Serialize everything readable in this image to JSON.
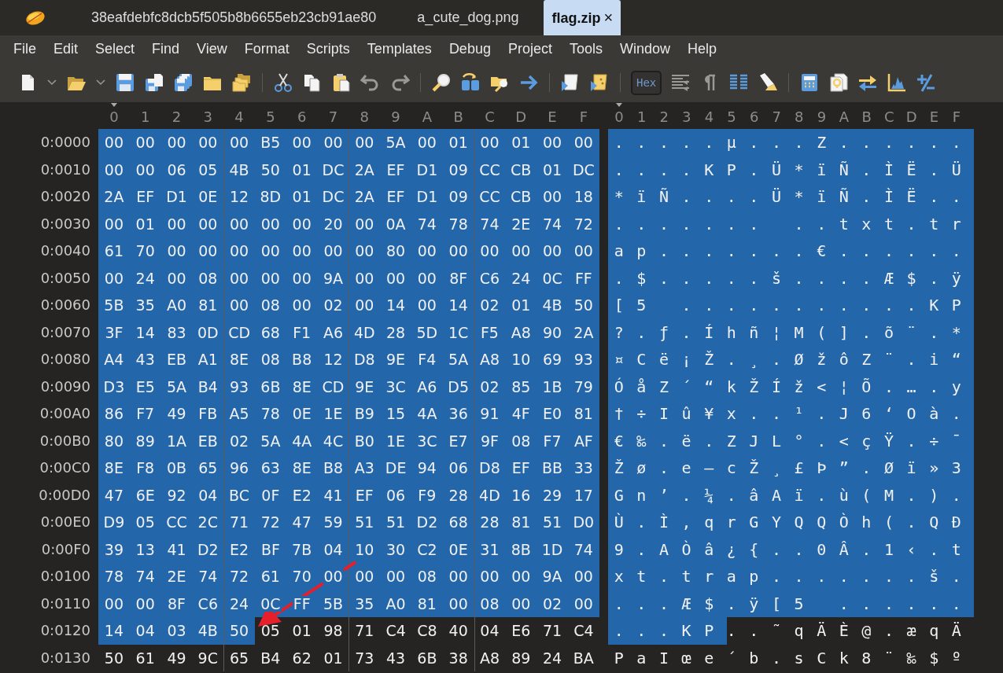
{
  "tabs": [
    {
      "label": "38eafdebfc8dcb5f505b8b6655eb23cb91ae80",
      "selected": false
    },
    {
      "label": "a_cute_dog.png",
      "selected": false
    },
    {
      "label": "flag.zip",
      "selected": true,
      "close": "×"
    }
  ],
  "menu": [
    "File",
    "Edit",
    "Select",
    "Find",
    "View",
    "Format",
    "Scripts",
    "Templates",
    "Debug",
    "Project",
    "Tools",
    "Window",
    "Help"
  ],
  "hex_toggle": {
    "label": "Hex",
    "on": true
  },
  "hex_columns": [
    {
      "label": "0",
      "cursor": true
    },
    {
      "label": "1",
      "cursor": false
    },
    {
      "label": "2",
      "cursor": false
    },
    {
      "label": "3",
      "cursor": false
    },
    {
      "label": "4",
      "cursor": false
    },
    {
      "label": "5",
      "cursor": false
    },
    {
      "label": "6",
      "cursor": false
    },
    {
      "label": "7",
      "cursor": false
    },
    {
      "label": "8",
      "cursor": false
    },
    {
      "label": "9",
      "cursor": false
    },
    {
      "label": "A",
      "cursor": false
    },
    {
      "label": "B",
      "cursor": false
    },
    {
      "label": "C",
      "cursor": false
    },
    {
      "label": "D",
      "cursor": false
    },
    {
      "label": "E",
      "cursor": false
    },
    {
      "label": "F",
      "cursor": false
    }
  ],
  "ascii_columns": [
    {
      "label": "0",
      "cursor": true
    },
    {
      "label": "1",
      "cursor": false
    },
    {
      "label": "2",
      "cursor": false
    },
    {
      "label": "3",
      "cursor": false
    },
    {
      "label": "4",
      "cursor": false
    },
    {
      "label": "5",
      "cursor": false
    },
    {
      "label": "6",
      "cursor": false
    },
    {
      "label": "7",
      "cursor": false
    },
    {
      "label": "8",
      "cursor": false
    },
    {
      "label": "9",
      "cursor": false
    },
    {
      "label": "A",
      "cursor": false
    },
    {
      "label": "B",
      "cursor": false
    },
    {
      "label": "C",
      "cursor": false
    },
    {
      "label": "D",
      "cursor": false
    },
    {
      "label": "E",
      "cursor": false
    },
    {
      "label": "F",
      "cursor": false
    }
  ],
  "rows": [
    {
      "offset": "0:0000",
      "hex_selected": [
        "00",
        "00",
        "00",
        "00",
        "00",
        "B5",
        "00",
        "00",
        "00",
        "5A",
        "00",
        "01",
        "00",
        "01",
        "00",
        "00"
      ],
      "ascii_selected": ".....µ...Z......"
    },
    {
      "offset": "0:0010",
      "hex_selected": [
        "00",
        "00",
        "06",
        "05",
        "4B",
        "50",
        "01",
        "DC",
        "2A",
        "EF",
        "D1",
        "09",
        "CC",
        "CB",
        "01",
        "DC"
      ],
      "ascii_selected": "....KP.Ü*ïÑ.ÌË.Ü"
    },
    {
      "offset": "0:0020",
      "hex_selected": [
        "2A",
        "EF",
        "D1",
        "0E",
        "12",
        "8D",
        "01",
        "DC",
        "2A",
        "EF",
        "D1",
        "09",
        "CC",
        "CB",
        "00",
        "18"
      ],
      "ascii_selected": "*ïÑ....Ü*ïÑ.ÌË.."
    },
    {
      "offset": "0:0030",
      "hex_selected": [
        "00",
        "01",
        "00",
        "00",
        "00",
        "00",
        "00",
        "20",
        "00",
        "0A",
        "74",
        "78",
        "74",
        "2E",
        "74",
        "72"
      ],
      "ascii_selected": "....... ..txt.tr"
    },
    {
      "offset": "0:0040",
      "hex_selected": [
        "61",
        "70",
        "00",
        "00",
        "00",
        "00",
        "00",
        "00",
        "00",
        "80",
        "00",
        "00",
        "00",
        "00",
        "00",
        "00"
      ],
      "ascii_selected": "ap.......€......"
    },
    {
      "offset": "0:0050",
      "hex_selected": [
        "00",
        "24",
        "00",
        "08",
        "00",
        "00",
        "00",
        "9A",
        "00",
        "00",
        "00",
        "8F",
        "C6",
        "24",
        "0C",
        "FF"
      ],
      "ascii_selected": ".$.....š....Æ$.ÿ"
    },
    {
      "offset": "0:0060",
      "hex_selected": [
        "5B",
        "35",
        "A0",
        "81",
        "00",
        "08",
        "00",
        "02",
        "00",
        "14",
        "00",
        "14",
        "02",
        "01",
        "4B",
        "50"
      ],
      "ascii_selected": "[5 ...........KP"
    },
    {
      "offset": "0:0070",
      "hex_selected": [
        "3F",
        "14",
        "83",
        "0D",
        "CD",
        "68",
        "F1",
        "A6",
        "4D",
        "28",
        "5D",
        "1C",
        "F5",
        "A8",
        "90",
        "2A"
      ],
      "ascii_selected": "?.ƒ.Íhñ¦M(].õ¨.*"
    },
    {
      "offset": "0:0080",
      "hex_selected": [
        "A4",
        "43",
        "EB",
        "A1",
        "8E",
        "08",
        "B8",
        "12",
        "D8",
        "9E",
        "F4",
        "5A",
        "A8",
        "10",
        "69",
        "93"
      ],
      "ascii_selected": "¤Cë¡Ž.¸.ØžôZ¨.i“"
    },
    {
      "offset": "0:0090",
      "hex_selected": [
        "D3",
        "E5",
        "5A",
        "B4",
        "93",
        "6B",
        "8E",
        "CD",
        "9E",
        "3C",
        "A6",
        "D5",
        "02",
        "85",
        "1B",
        "79"
      ],
      "ascii_selected": "ÓåZ´“kŽÍž<¦Õ.….y"
    },
    {
      "offset": "0:00A0",
      "hex_selected": [
        "86",
        "F7",
        "49",
        "FB",
        "A5",
        "78",
        "0E",
        "1E",
        "B9",
        "15",
        "4A",
        "36",
        "91",
        "4F",
        "E0",
        "81"
      ],
      "ascii_selected": "†÷Iû¥x..¹.J6‘Oà."
    },
    {
      "offset": "0:00B0",
      "hex_selected": [
        "80",
        "89",
        "1A",
        "EB",
        "02",
        "5A",
        "4A",
        "4C",
        "B0",
        "1E",
        "3C",
        "E7",
        "9F",
        "08",
        "F7",
        "AF"
      ],
      "ascii_selected": "€‰.ë.ZJL°.<çŸ.÷¯"
    },
    {
      "offset": "0:00C0",
      "hex_selected": [
        "8E",
        "F8",
        "0B",
        "65",
        "96",
        "63",
        "8E",
        "B8",
        "A3",
        "DE",
        "94",
        "06",
        "D8",
        "EF",
        "BB",
        "33"
      ],
      "ascii_selected": "Žø.e–cŽ¸£Þ”.Øï»3"
    },
    {
      "offset": "0:00D0",
      "hex_selected": [
        "47",
        "6E",
        "92",
        "04",
        "BC",
        "0F",
        "E2",
        "41",
        "EF",
        "06",
        "F9",
        "28",
        "4D",
        "16",
        "29",
        "17"
      ],
      "ascii_selected": "Gn’.¼.âAï.ù(M.)."
    },
    {
      "offset": "0:00E0",
      "hex_selected": [
        "D9",
        "05",
        "CC",
        "2C",
        "71",
        "72",
        "47",
        "59",
        "51",
        "51",
        "D2",
        "68",
        "28",
        "81",
        "51",
        "D0"
      ],
      "ascii_selected": "Ù.Ì,qrGYQQÒh(.QÐ"
    },
    {
      "offset": "0:00F0",
      "hex_selected": [
        "39",
        "13",
        "41",
        "D2",
        "E2",
        "BF",
        "7B",
        "04",
        "10",
        "30",
        "C2",
        "0E",
        "31",
        "8B",
        "1D",
        "74"
      ],
      "ascii_selected": "9.AÒâ¿{..0Â.1‹.t"
    },
    {
      "offset": "0:0100",
      "hex_selected": [
        "78",
        "74",
        "2E",
        "74",
        "72",
        "61",
        "70",
        "00",
        "00",
        "00",
        "08",
        "00",
        "00",
        "00",
        "9A",
        "00"
      ],
      "ascii_selected": "xt.trap.......š."
    },
    {
      "offset": "0:0110",
      "hex_selected": [
        "00",
        "00",
        "8F",
        "C6",
        "24",
        "0C",
        "FF",
        "5B",
        "35",
        "A0",
        "81",
        "00",
        "08",
        "00",
        "02",
        "00"
      ],
      "ascii_selected": "...Æ$.ÿ[5 ......"
    },
    {
      "offset": "0:0120",
      "hex_selected": [
        "14",
        "04",
        "03",
        "4B",
        "50"
      ],
      "hex_unselected": [
        "05",
        "01",
        "98",
        "71",
        "C4",
        "C8",
        "40",
        "04",
        "E6",
        "71",
        "C4"
      ],
      "ascii_selected": "...KP",
      "ascii_unselected": "..˜qÄÈ@.æqÄ"
    },
    {
      "offset": "0:0130",
      "hex_unselected": [
        "50",
        "61",
        "49",
        "9C",
        "65",
        "B4",
        "62",
        "01",
        "73",
        "43",
        "6B",
        "38",
        "A8",
        "89",
        "24",
        "BA"
      ],
      "ascii_unselected": "PaIœe´b.sCk8¨‰$º"
    }
  ]
}
